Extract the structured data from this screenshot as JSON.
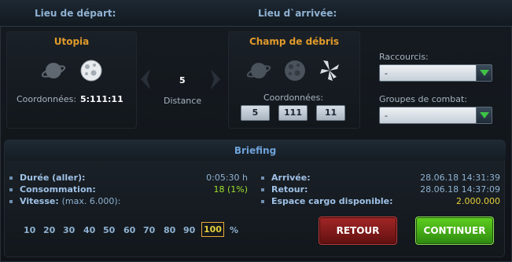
{
  "header": {
    "departure": "Lieu de départ:",
    "arrival": "Lieu d`arrivée:"
  },
  "departure": {
    "planet_name": "Utopia",
    "coords_label": "Coordonnées:",
    "coords_value": "5:111:11"
  },
  "distance": {
    "value": "5",
    "label": "Distance"
  },
  "arrival": {
    "planet_name": "Champ de débris",
    "coords_label": "Coordonnées:",
    "galaxy": "5",
    "system": "111",
    "position": "11"
  },
  "shortcuts": {
    "label": "Raccourcis:",
    "selected": "-"
  },
  "combat_groups": {
    "label": "Groupes de combat:",
    "selected": "-"
  },
  "briefing": {
    "title": "Briefing",
    "duration_label": "Durée (aller):",
    "duration_value": "0:05:30 h",
    "consumption_label": "Consommation:",
    "consumption_value": "18 (1%)",
    "speed_label": "Vitesse:",
    "speed_max": "(max. 6.000):",
    "arrival_label": "Arrivée:",
    "arrival_value": "28.06.18 14:31:39",
    "return_label": "Retour:",
    "return_value": "28.06.18 14:37:09",
    "cargo_label": "Espace cargo disponible:",
    "cargo_value": "2.000.000"
  },
  "speeds": [
    "10",
    "20",
    "30",
    "40",
    "50",
    "60",
    "70",
    "80",
    "90",
    "100"
  ],
  "speed_unit": "%",
  "speed_selected": "100",
  "buttons": {
    "back": "RETOUR",
    "continue": "CONTINUER"
  },
  "colors": {
    "accent_blue": "#8fb2d2",
    "planet_name": "#e09a2a",
    "value_green": "#9fe02a",
    "select_green": "#3fc246",
    "back_red": "#a22626",
    "continue_green": "#5fcf1f"
  }
}
